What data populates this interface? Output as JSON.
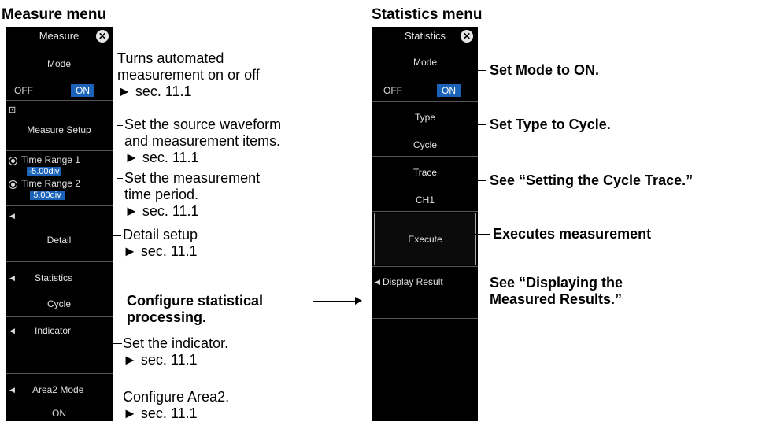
{
  "headings": {
    "measure": "Measure menu",
    "statistics": "Statistics menu"
  },
  "measure_menu": {
    "title": "Measure",
    "mode_label": "Mode",
    "mode_off": "OFF",
    "mode_on": "ON",
    "setup_label": "Measure Setup",
    "time_range1_label": "Time Range 1",
    "time_range1_value": "-5.00div",
    "time_range2_label": "Time Range 2",
    "time_range2_value": "5.00div",
    "detail_label": "Detail",
    "statistics_label": "Statistics",
    "statistics_value": "Cycle",
    "indicator_label": "Indicator",
    "area2_label": "Area2 Mode",
    "area2_value": "ON"
  },
  "statistics_menu": {
    "title": "Statistics",
    "mode_label": "Mode",
    "mode_off": "OFF",
    "mode_on": "ON",
    "type_label": "Type",
    "type_value": "Cycle",
    "trace_label": "Trace",
    "trace_value": "CH1",
    "execute_label": "Execute",
    "display_result_label": "Display Result"
  },
  "annotations": {
    "mode": [
      "Turns automated",
      "measurement on or off",
      "► sec. 11.1"
    ],
    "setup": [
      "Set the source waveform",
      "and measurement items.",
      "► sec. 11.1"
    ],
    "time": [
      "Set the measurement",
      "time period.",
      "► sec. 11.1"
    ],
    "detail": [
      "Detail setup",
      "► sec. 11.1"
    ],
    "statistics": [
      "Configure statistical",
      "processing."
    ],
    "indicator": [
      "Set the indicator.",
      "► sec. 11.1"
    ],
    "area2": [
      "Configure Area2.",
      "► sec. 11.1"
    ],
    "s_mode": "Set Mode to ON.",
    "s_type": "Set Type to Cycle.",
    "s_trace": "See “Setting the Cycle Trace.”",
    "s_execute": "Executes measurement",
    "s_display": [
      "See “Displaying the",
      "Measured Results.”"
    ]
  }
}
